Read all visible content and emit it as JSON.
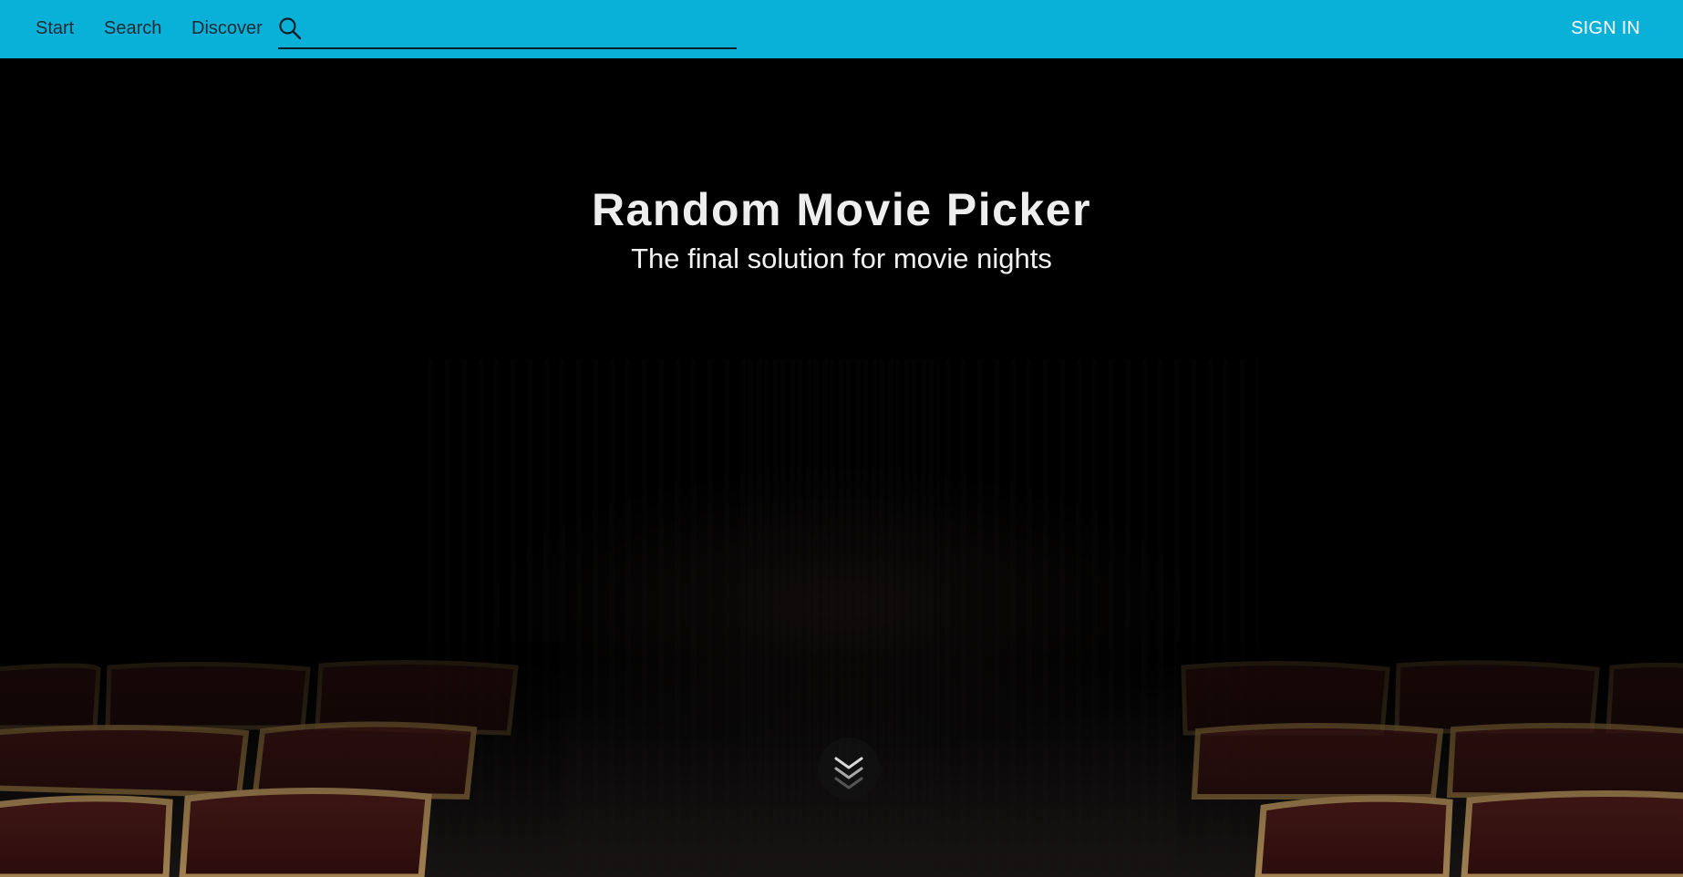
{
  "nav": {
    "links": [
      "Start",
      "Search",
      "Discover"
    ],
    "search_value": "",
    "search_placeholder": "",
    "sign_in": "SIGN IN",
    "accent_color": "#09b0d8"
  },
  "hero": {
    "title": "Random Movie Picker",
    "subtitle": "The final solution for movie nights",
    "scroll_icon": "double-chevron-down-icon",
    "background": "dark cinema with red theater seats"
  }
}
